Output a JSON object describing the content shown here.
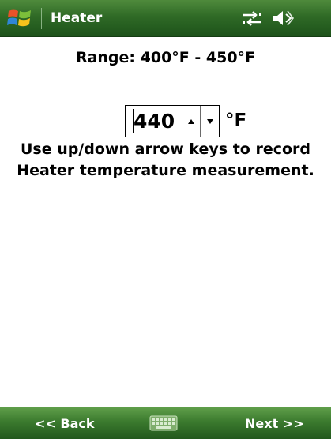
{
  "titlebar": {
    "title": "Heater",
    "icons": [
      "windows-flag-icon",
      "connectivity-icon",
      "volume-icon"
    ]
  },
  "range": {
    "label": "Range: 400°F - 450°F"
  },
  "entry": {
    "value": "440",
    "unit": "°F"
  },
  "instructions": {
    "text": "Use up/down arrow keys to record Heater temperature measurement."
  },
  "softbar": {
    "back_label": "<< Back",
    "next_label": "Next >>",
    "keyboard_icon": "keyboard-icon"
  },
  "colors": {
    "bar_green": "#2f6a26",
    "softbar_green": "#3b7a2e",
    "text": "#000000",
    "bar_text": "#ffffff"
  }
}
